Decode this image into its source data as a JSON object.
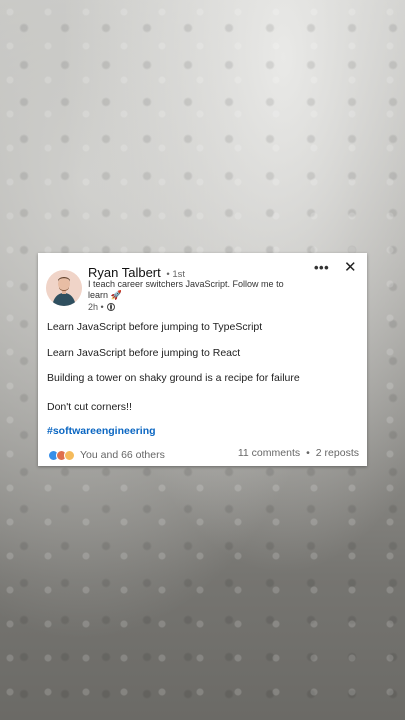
{
  "post": {
    "author": {
      "name": "Ryan Talbert",
      "connection": "• 1st",
      "headline": "I teach career switchers JavaScript. Follow me to learn 🚀",
      "time": "2h •"
    },
    "lines": [
      "Learn JavaScript before jumping to TypeScript",
      "Learn JavaScript before jumping to React",
      "Building a tower on shaky ground is a recipe for failure",
      "Don't cut corners!!"
    ],
    "hashtag": "#softwareengineering",
    "social": {
      "reactions_text": "You and 66 others",
      "comments": "11 comments",
      "separator": "•",
      "reposts": "2 reposts"
    },
    "menu_glyph": "•••",
    "close_glyph": "✕"
  },
  "icons": [
    "globe-icon",
    "like-icon",
    "love-icon",
    "insightful-icon",
    "more-icon",
    "close-icon"
  ],
  "colors": {
    "link": "#0a66c2",
    "like": "#378fe9",
    "love": "#df704d",
    "insightful": "#f5bb5c"
  }
}
